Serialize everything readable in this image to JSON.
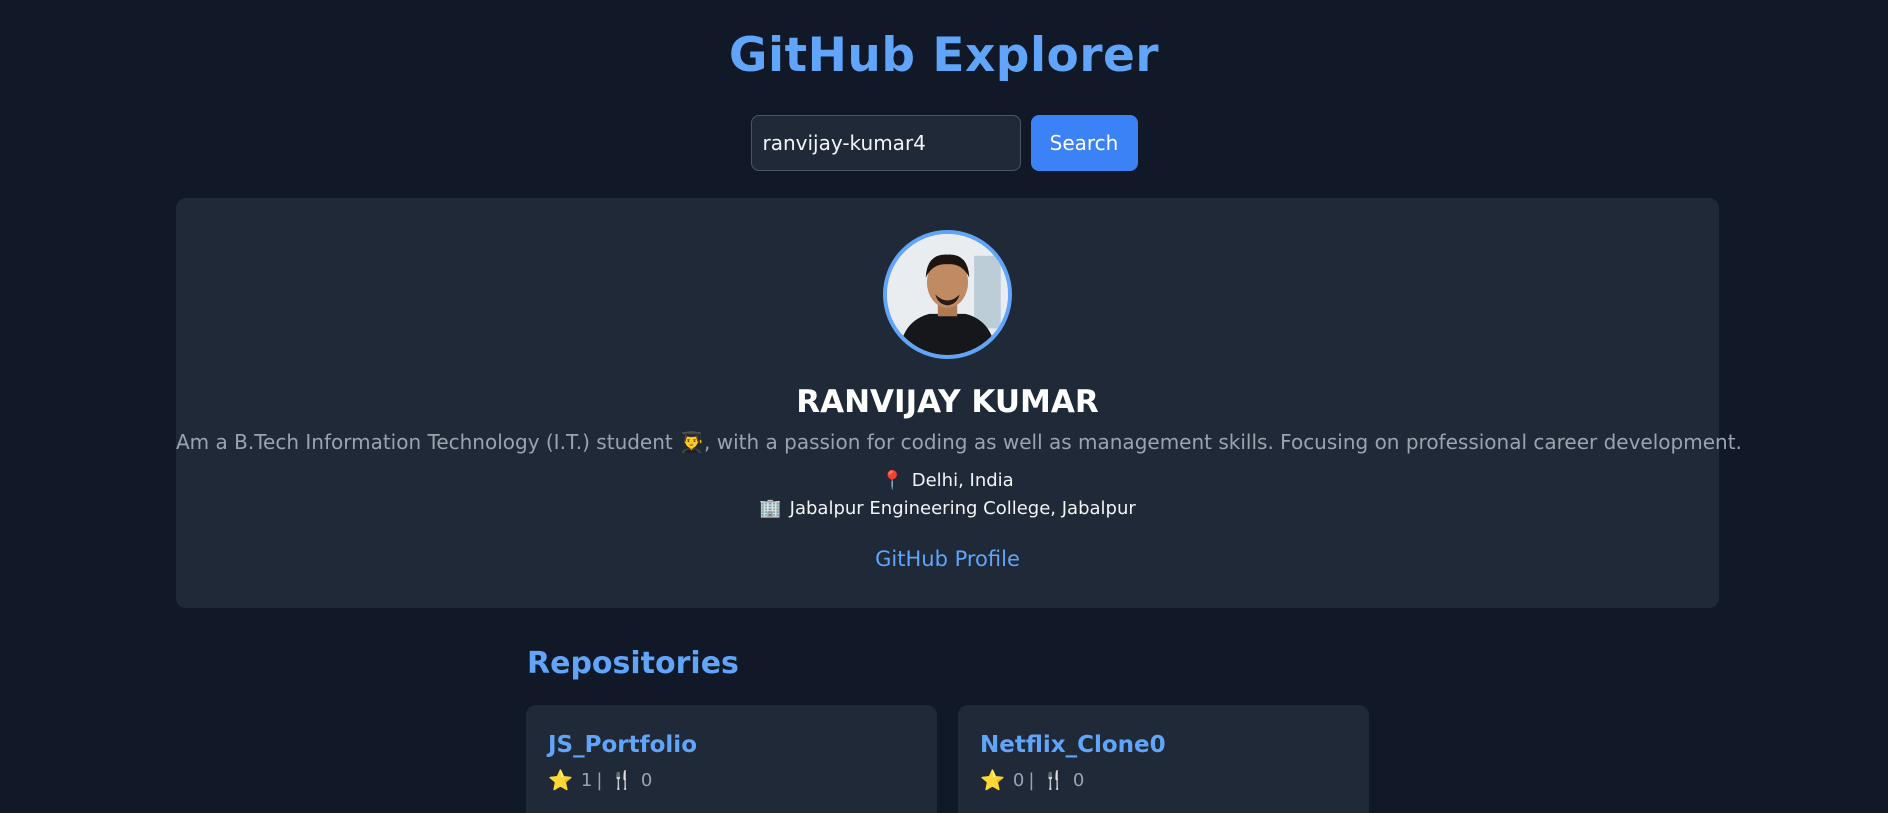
{
  "app": {
    "title": "GitHub Explorer"
  },
  "search": {
    "value": "ranvijay-kumar4",
    "button_label": "Search"
  },
  "profile": {
    "name": "RANVIJAY KUMAR",
    "bio": "Am a B.Tech Information Technology (I.T.) student 👨‍🎓, with a passion for coding as well as management skills. Focusing on professional career development.",
    "location_icon": "📍",
    "location": "Delhi, India",
    "company_icon": "🏢",
    "company": "Jabalpur Engineering College, Jabalpur",
    "link_label": "GitHub Profile"
  },
  "repos": {
    "heading": "Repositories",
    "items": [
      {
        "name": "JS_Portfolio",
        "stars": "1",
        "forks": "0"
      },
      {
        "name": "Netflix_Clone0",
        "stars": "0",
        "forks": "0"
      }
    ],
    "star_icon": "⭐",
    "fork_icon": "🍴",
    "separator": "|"
  },
  "colors": {
    "accent": "#60a5fa",
    "button": "#3b82f6",
    "background": "#111827",
    "card": "#1f2937"
  }
}
